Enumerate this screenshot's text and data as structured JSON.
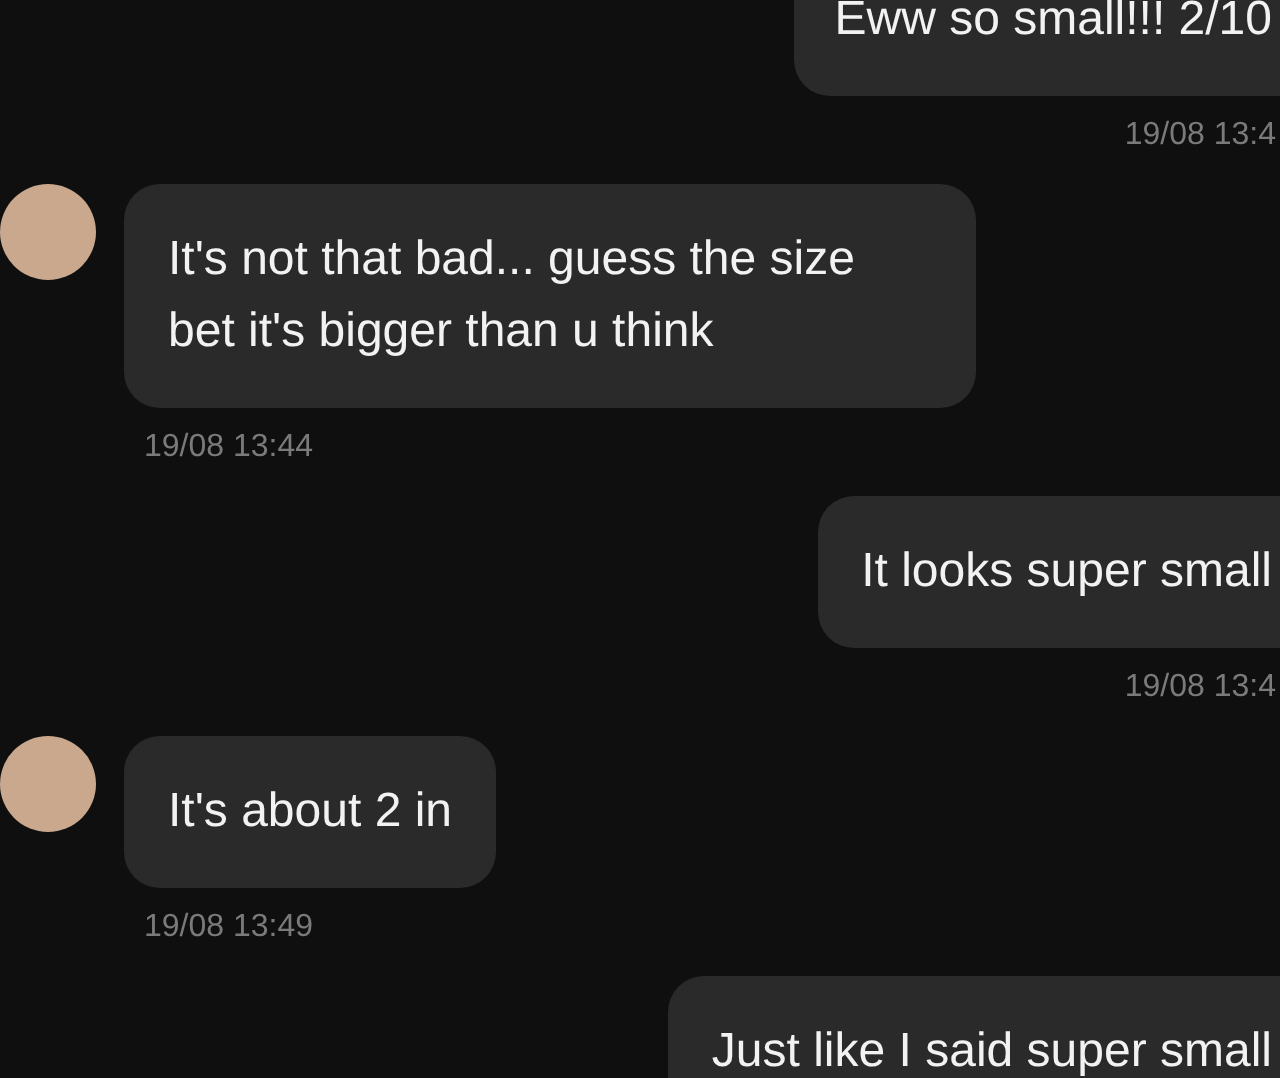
{
  "messages": [
    {
      "kind": "outgoing",
      "text": "Eww so small!!! 2/10",
      "time": "19/08 13:4"
    },
    {
      "kind": "incoming",
      "text": "It's not that bad... guess the size bet it's bigger than u think",
      "time": "19/08 13:44"
    },
    {
      "kind": "outgoing",
      "text": "It looks super small",
      "time": "19/08 13:4"
    },
    {
      "kind": "incoming",
      "text": "It's about 2 in",
      "time": "19/08 13:49"
    },
    {
      "kind": "outgoing",
      "text": "Just like I said super small"
    }
  ]
}
